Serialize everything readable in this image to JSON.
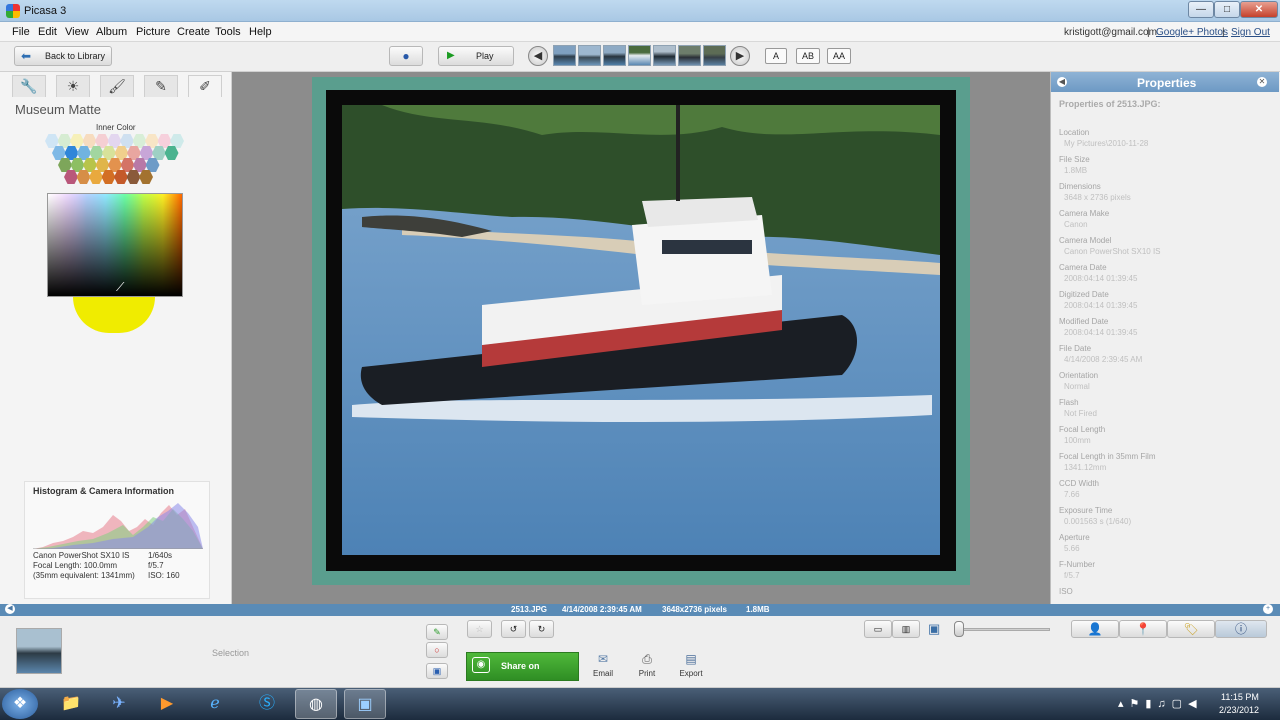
{
  "window": {
    "title": "Picasa 3",
    "minimize": "—",
    "maximize": "□",
    "close": "✕"
  },
  "menu": {
    "items": [
      "File",
      "Edit",
      "View",
      "Album",
      "Picture",
      "Create",
      "Tools",
      "Help"
    ],
    "email": "kristigott@gmail.com",
    "separator": "|",
    "photos_link": "Google+ Photos",
    "signout_link": "Sign Out"
  },
  "toolbar": {
    "back_label": "Back to Library",
    "play_label": "Play",
    "caption_buttons": [
      "A",
      "AB",
      "AA"
    ]
  },
  "left_panel": {
    "tab_icons": [
      "wrench-icon",
      "sun-icon",
      "brush-icon",
      "tuning-icon",
      "effects-icon"
    ],
    "tab_glyphs": [
      "🔧",
      "☀",
      "🖌",
      "✎",
      "✐"
    ],
    "effect_title": "Museum Matte",
    "inner_color_label": "Inner Color",
    "histogram": {
      "title": "Histogram & Camera Information",
      "camera": "Canon PowerShot SX10 IS",
      "shutter": "1/640s",
      "focal": "Focal Length: 100.0mm",
      "fstop": "f/5.7",
      "equiv": "(35mm equivalent: 1341mm)",
      "iso": "ISO: 160"
    }
  },
  "properties": {
    "header": "Properties",
    "subtitle": "Properties of 2513.JPG:",
    "rows": [
      {
        "label": "Location",
        "value": "My Pictures\\2010-11-28"
      },
      {
        "label": "File Size",
        "value": "1.8MB"
      },
      {
        "label": "Dimensions",
        "value": "3648 x 2736 pixels"
      },
      {
        "label": "Camera Make",
        "value": "Canon"
      },
      {
        "label": "Camera Model",
        "value": "Canon PowerShot SX10 IS"
      },
      {
        "label": "Camera Date",
        "value": "2008:04:14 01:39:45"
      },
      {
        "label": "Digitized Date",
        "value": "2008:04:14 01:39:45"
      },
      {
        "label": "Modified Date",
        "value": "2008:04:14 01:39:45"
      },
      {
        "label": "File Date",
        "value": "4/14/2008 2:39:45 AM"
      },
      {
        "label": "Orientation",
        "value": "Normal"
      },
      {
        "label": "Flash",
        "value": "Not Fired"
      },
      {
        "label": "Focal Length",
        "value": "100mm"
      },
      {
        "label": "Focal Length in 35mm Film",
        "value": "1341.12mm"
      },
      {
        "label": "CCD Width",
        "value": "7.66"
      },
      {
        "label": "Exposure Time",
        "value": "0.001563 s (1/640)"
      },
      {
        "label": "Aperture",
        "value": "5.66"
      },
      {
        "label": "F-Number",
        "value": "f/5.7"
      },
      {
        "label": "ISO",
        "value": ""
      }
    ]
  },
  "status": {
    "filename": "2513.JPG",
    "date": "4/14/2008 2:39:45 AM",
    "dimensions": "3648x2736 pixels",
    "size": "1.8MB"
  },
  "tray": {
    "selection_label": "Selection",
    "share_label": "Share on Google+",
    "email_label": "Email",
    "print_label": "Print",
    "export_label": "Export"
  },
  "taskbar": {
    "time": "11:15 PM",
    "date": "2/23/2012"
  }
}
